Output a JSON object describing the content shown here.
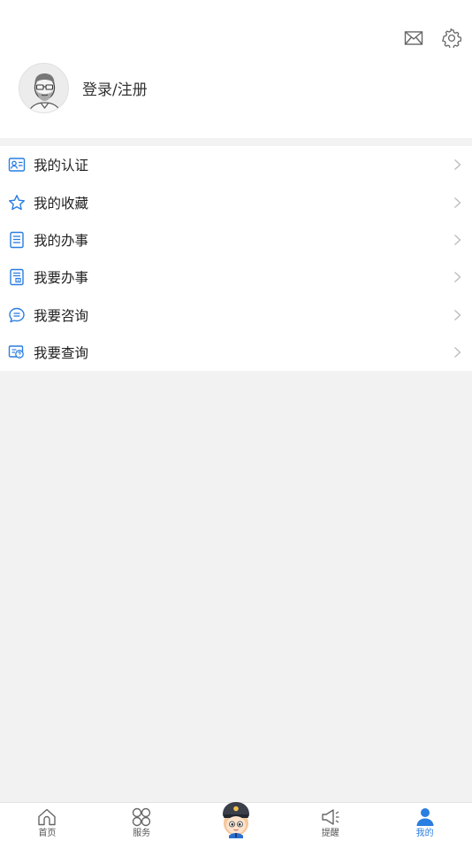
{
  "header": {
    "icons": [
      "mail-icon",
      "settings-gear-icon"
    ]
  },
  "profile": {
    "login_text": "登录/注册",
    "avatar_icon": "user-avatar-icon"
  },
  "menu": {
    "items": [
      {
        "label": "我的认证",
        "icon": "id-card-icon"
      },
      {
        "label": "我的收藏",
        "icon": "star-icon"
      },
      {
        "label": "我的办事",
        "icon": "document-list-icon"
      },
      {
        "label": "我要办事",
        "icon": "form-document-icon"
      },
      {
        "label": "我要咨询",
        "icon": "chat-bubble-icon"
      },
      {
        "label": "我要查询",
        "icon": "query-icon"
      }
    ]
  },
  "bottom_nav": {
    "items": [
      {
        "label": "首页",
        "icon": "home-icon"
      },
      {
        "label": "服务",
        "icon": "services-grid-icon"
      },
      {
        "label": "",
        "icon": "police-mascot-icon"
      },
      {
        "label": "提醒",
        "icon": "megaphone-icon"
      },
      {
        "label": "我的",
        "icon": "person-icon",
        "active": true
      }
    ]
  },
  "colors": {
    "accent": "#2a7de1",
    "background": "#f2f2f2"
  }
}
